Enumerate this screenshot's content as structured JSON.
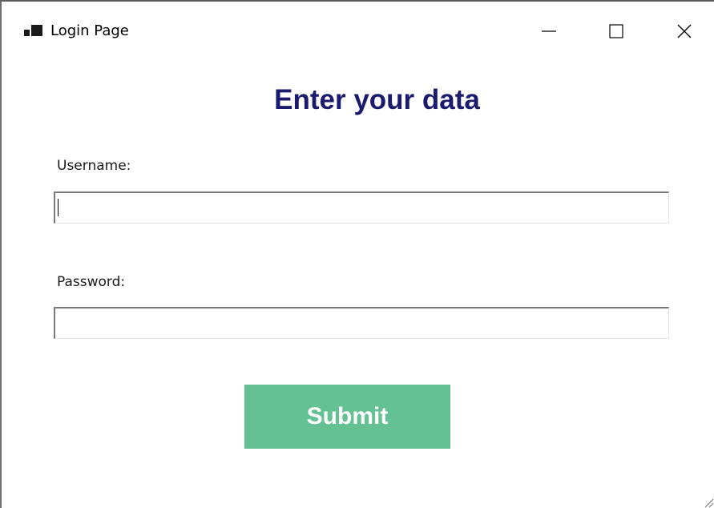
{
  "window": {
    "title": "Login Page",
    "icon": "app-window-icon",
    "controls": {
      "minimize_icon": "minimize-icon",
      "maximize_icon": "maximize-icon",
      "close_icon": "close-icon"
    }
  },
  "form": {
    "heading": "Enter your data",
    "username": {
      "label": "Username:",
      "value": "",
      "focused": true
    },
    "password": {
      "label": "Password:",
      "value": ""
    },
    "submit_label": "Submit"
  },
  "colors": {
    "heading": "#1a1a6e",
    "submit_background": "#64c193",
    "submit_text": "#ffffff"
  }
}
